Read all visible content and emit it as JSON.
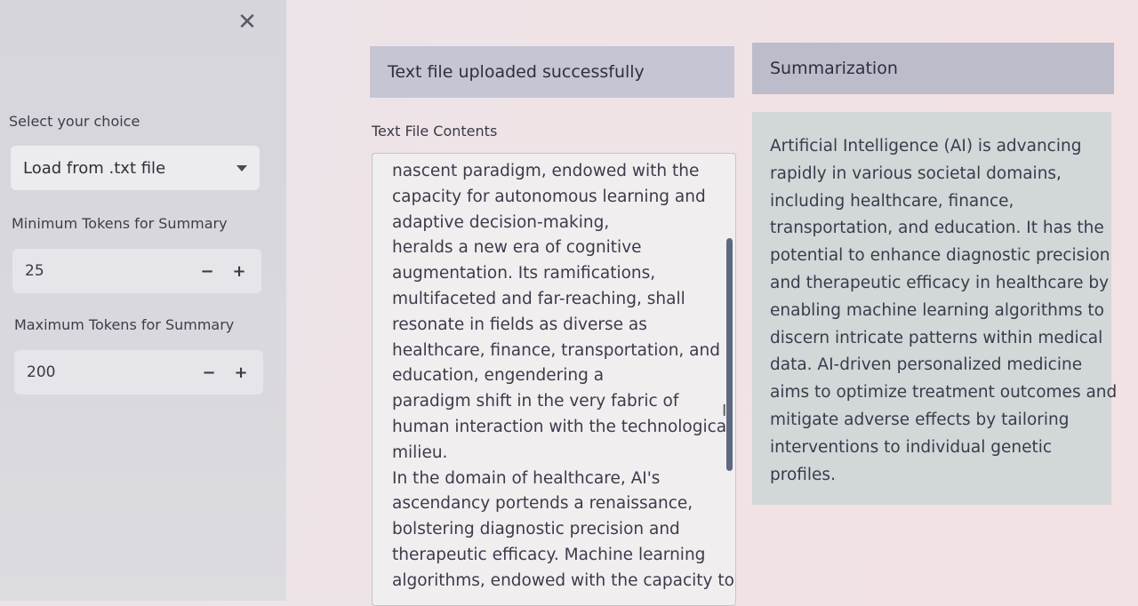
{
  "sidebar": {
    "close_icon": "close-icon",
    "choice_label": "Select your choice",
    "choice_value": "Load from .txt file",
    "min_label": "Minimum Tokens for Summary",
    "min_value": "25",
    "max_label": "Maximum Tokens for Summary",
    "max_value": "200",
    "minus": "−",
    "plus": "+"
  },
  "main": {
    "success_message": "Text file uploaded successfully",
    "contents_label": "Text File Contents",
    "contents_lines": [
      "nascent paradigm, endowed with the",
      "capacity for autonomous learning and",
      "adaptive decision-making,",
      "heralds a new era of cognitive",
      "augmentation. Its ramifications,",
      "multifaceted and far-reaching, shall",
      "resonate in fields as diverse as",
      "healthcare, finance, transportation, and",
      "education, engendering a",
      "paradigm shift in the very fabric of",
      "human interaction with the technological",
      "milieu.",
      "In the domain of healthcare, AI's",
      "ascendancy portends a renaissance,",
      "bolstering diagnostic precision and",
      "therapeutic efficacy. Machine learning",
      "algorithms, endowed with the capacity to"
    ]
  },
  "summary": {
    "heading": "Summarization",
    "lines": [
      "Artificial Intelligence (AI) is advancing",
      "rapidly in various societal domains,",
      "including healthcare, finance,",
      "transportation, and education. It has the",
      "potential to enhance diagnostic precision",
      "and therapeutic efficacy in healthcare by",
      "enabling machine learning algorithms to",
      "discern intricate patterns within medical",
      "data. AI-driven personalized medicine",
      "aims to optimize treatment outcomes and",
      "mitigate adverse effects by tailoring",
      "interventions to individual genetic",
      "profiles."
    ]
  }
}
